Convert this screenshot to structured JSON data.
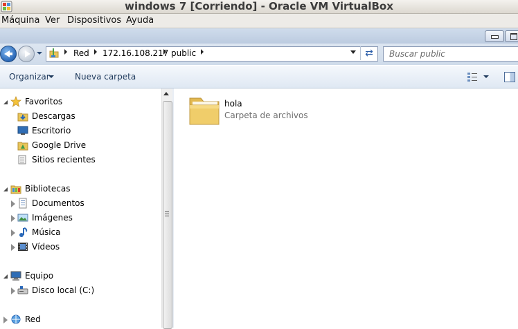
{
  "vbox": {
    "title": "windows 7 [Corriendo] - Oracle VM VirtualBox",
    "menu": [
      "Máquina",
      "Ver",
      "Dispositivos",
      "Ayuda"
    ]
  },
  "address": {
    "crumbs": [
      "Red",
      "172.16.108.217",
      "public"
    ]
  },
  "search": {
    "placeholder": "Buscar public"
  },
  "toolbar": {
    "organize": "Organizar",
    "new_folder": "Nueva carpeta"
  },
  "nav": {
    "favorites": {
      "label": "Favoritos",
      "items": [
        "Descargas",
        "Escritorio",
        "Google Drive",
        "Sitios recientes"
      ]
    },
    "libraries": {
      "label": "Bibliotecas",
      "items": [
        "Documentos",
        "Imágenes",
        "Música",
        "Vídeos"
      ]
    },
    "computer": {
      "label": "Equipo",
      "items": [
        "Disco local (C:)"
      ]
    },
    "network": {
      "label": "Red"
    }
  },
  "content": {
    "items": [
      {
        "name": "hola",
        "type": "Carpeta de archivos",
        "icon": "folder-icon"
      }
    ]
  },
  "icons": {
    "favorites": "star-icon",
    "downloads": "downloads-folder-icon",
    "desktop": "desktop-icon",
    "google_drive": "google-drive-folder-icon",
    "recent": "recent-places-icon",
    "libraries": "libraries-icon",
    "documents": "documents-icon",
    "pictures": "pictures-icon",
    "music": "music-icon",
    "videos": "videos-icon",
    "computer": "computer-icon",
    "local_disk": "hard-disk-icon",
    "network": "network-icon"
  },
  "colors": {
    "command_text": "#1e395b",
    "secondary_text": "#6d6d6d",
    "accent": "#2a68b8"
  }
}
